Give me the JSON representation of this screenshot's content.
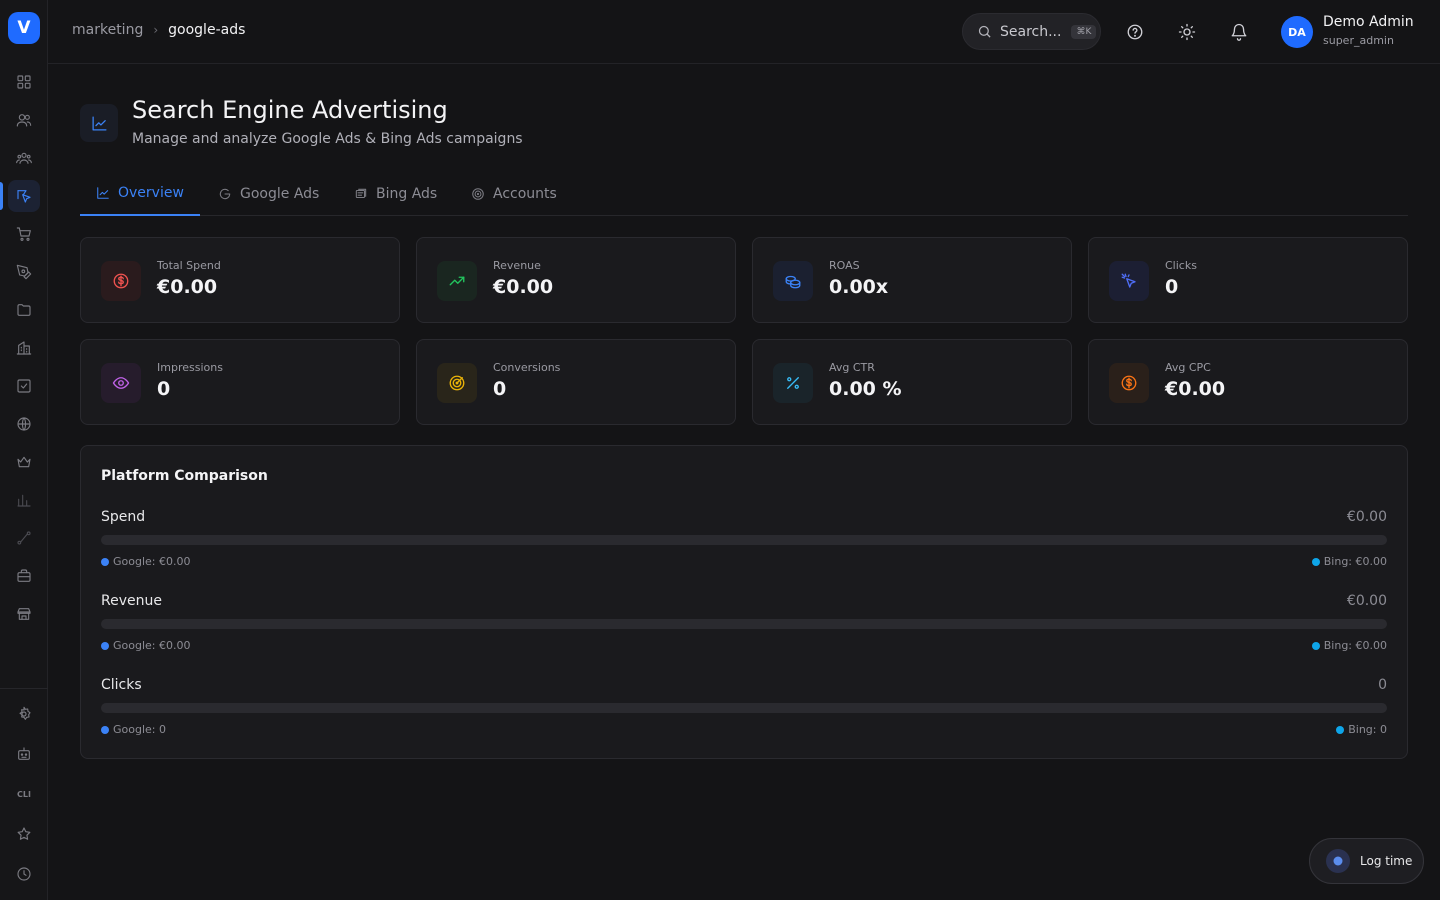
{
  "sidebar": {
    "logo": "V",
    "items": [
      {
        "icon": "dashboard-grid-icon",
        "active": false
      },
      {
        "icon": "users-icon",
        "active": false
      },
      {
        "icon": "team-icon",
        "active": false
      },
      {
        "icon": "marketing-send-icon",
        "active": true
      },
      {
        "icon": "cart-icon",
        "active": false
      },
      {
        "icon": "pen-tool-icon",
        "active": false
      },
      {
        "icon": "folder-icon",
        "active": false
      },
      {
        "icon": "building-icon",
        "active": false
      },
      {
        "icon": "checkbox-icon",
        "active": false
      },
      {
        "icon": "globe-icon",
        "active": false
      },
      {
        "icon": "crown-icon",
        "active": false
      },
      {
        "icon": "bar-chart-icon",
        "active": false
      },
      {
        "icon": "route-icon",
        "active": false
      },
      {
        "icon": "briefcase-icon",
        "active": false
      },
      {
        "icon": "store-icon",
        "active": false
      }
    ],
    "bottom_items": [
      {
        "icon": "settings-icon"
      },
      {
        "icon": "bot-icon"
      },
      {
        "icon": "cli-icon",
        "label": "CLI"
      },
      {
        "icon": "star-icon"
      },
      {
        "icon": "clock-icon"
      }
    ]
  },
  "topbar": {
    "breadcrumb": {
      "parent": "marketing",
      "current": "google-ads"
    },
    "search": {
      "placeholder": "Search...",
      "shortcut": "⌘K"
    },
    "user": {
      "initials": "DA",
      "name": "Demo Admin",
      "role": "super_admin"
    }
  },
  "header": {
    "title": "Search Engine Advertising",
    "subtitle": "Manage and analyze Google Ads & Bing Ads campaigns"
  },
  "tabs": [
    {
      "label": "Overview",
      "icon": "line-chart-icon",
      "active": true
    },
    {
      "label": "Google Ads",
      "icon": "google-icon",
      "active": false
    },
    {
      "label": "Bing Ads",
      "icon": "bing-icon",
      "active": false
    },
    {
      "label": "Accounts",
      "icon": "target-icon",
      "active": false
    }
  ],
  "stats": [
    {
      "label": "Total Spend",
      "value": "€0.00",
      "icon": "dollar-circle-icon",
      "color": "#ef5350",
      "bg": "#2a1b1d"
    },
    {
      "label": "Revenue",
      "value": "€0.00",
      "icon": "trend-up-icon",
      "color": "#22c55e",
      "bg": "#1a2620"
    },
    {
      "label": "ROAS",
      "value": "0.00x",
      "icon": "coins-icon",
      "color": "#3b82f6",
      "bg": "#1b2030"
    },
    {
      "label": "Clicks",
      "value": "0",
      "icon": "cursor-click-icon",
      "color": "#4f6ef7",
      "bg": "#1c1f33"
    },
    {
      "label": "Impressions",
      "value": "0",
      "icon": "eye-icon",
      "color": "#c062e8",
      "bg": "#261c2c"
    },
    {
      "label": "Conversions",
      "value": "0",
      "icon": "target-icon",
      "color": "#eab308",
      "bg": "#29251a"
    },
    {
      "label": "Avg CTR",
      "value": "0.00 %",
      "icon": "percent-icon",
      "color": "#38bdf8",
      "bg": "#1a242a"
    },
    {
      "label": "Avg CPC",
      "value": "€0.00",
      "icon": "dollar-circle-icon",
      "color": "#f97316",
      "bg": "#2a201a"
    }
  ],
  "comparison": {
    "title": "Platform Comparison",
    "metrics": [
      {
        "name": "Spend",
        "total": "€0.00",
        "google": "Google: €0.00",
        "bing": "Bing: €0.00",
        "google_share": 0
      },
      {
        "name": "Revenue",
        "total": "€0.00",
        "google": "Google: €0.00",
        "bing": "Bing: €0.00",
        "google_share": 0
      },
      {
        "name": "Clicks",
        "total": "0",
        "google": "Google: 0",
        "bing": "Bing: 0",
        "google_share": 0
      }
    ],
    "colors": {
      "google": "#3b82f6",
      "bing": "#0ea5e9"
    }
  },
  "log_time": {
    "label": "Log time",
    "icon": "timer-icon"
  }
}
